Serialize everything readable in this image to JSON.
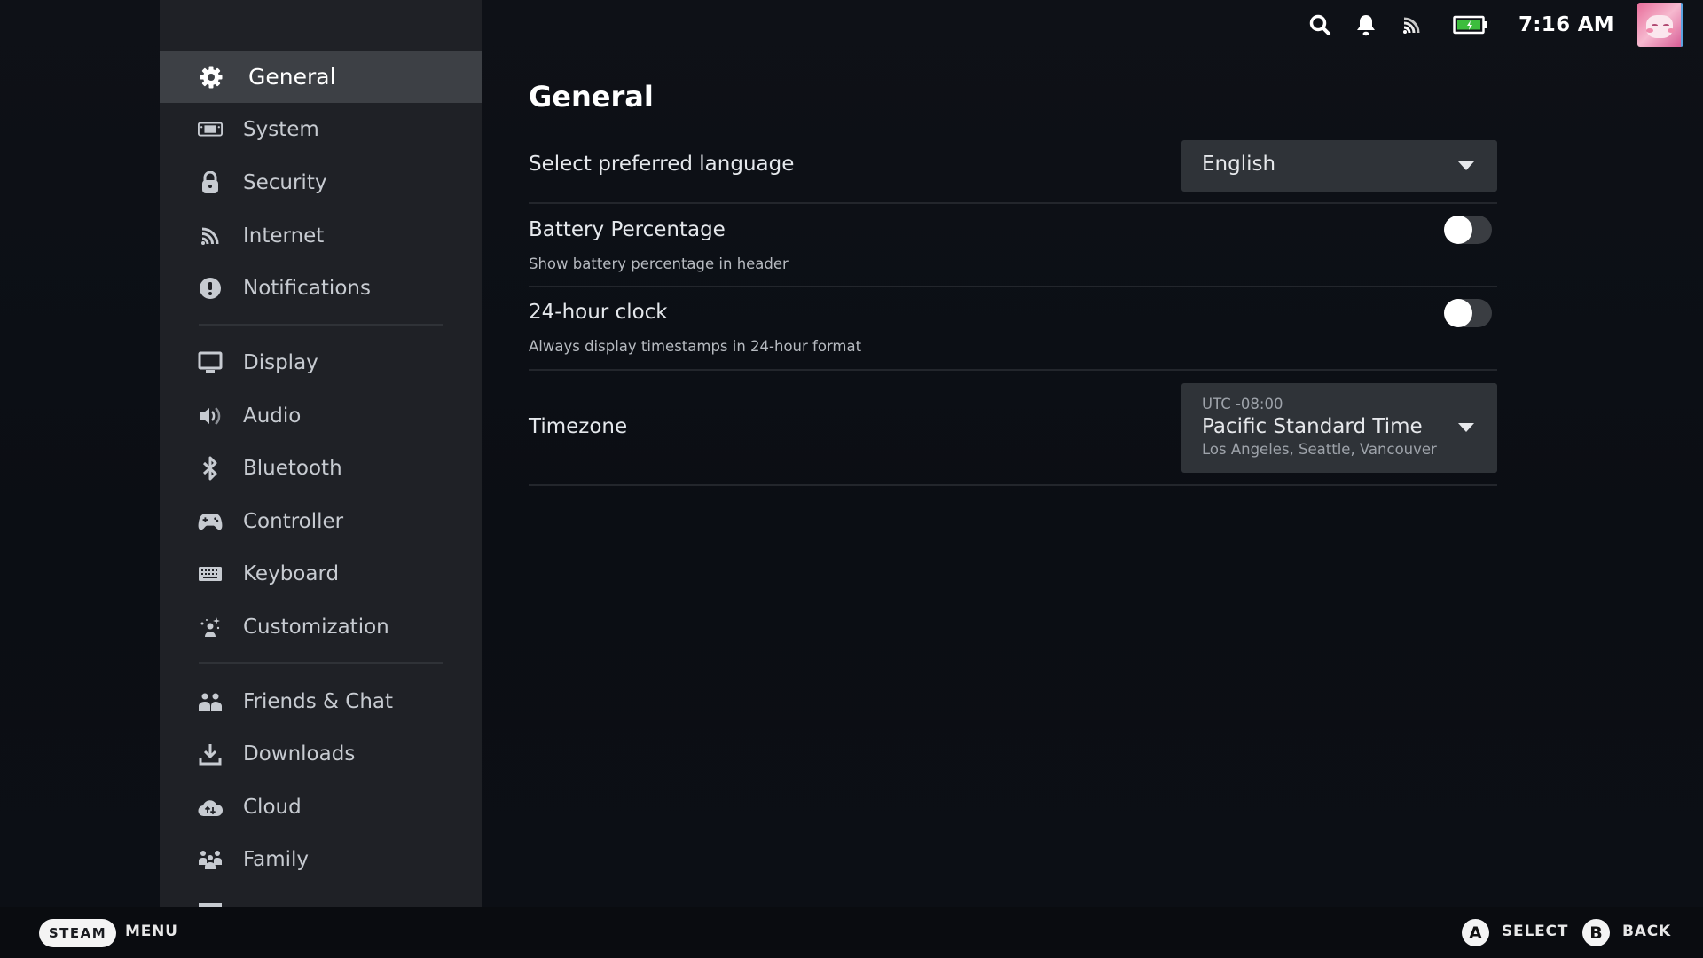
{
  "header": {
    "time": "7:16 AM",
    "icons": [
      "search-icon",
      "bell-icon",
      "wifi-icon",
      "battery-charging-icon",
      "avatar"
    ],
    "battery_color": "#3dbd3d"
  },
  "sidebar": {
    "items": [
      {
        "label": "General",
        "icon": "gear-icon",
        "active": true
      },
      {
        "label": "System",
        "icon": "handheld-device-icon"
      },
      {
        "label": "Security",
        "icon": "lock-icon"
      },
      {
        "label": "Internet",
        "icon": "wifi-icon"
      },
      {
        "label": "Notifications",
        "icon": "alert-circle-icon"
      },
      {
        "label": "Display",
        "icon": "monitor-icon"
      },
      {
        "label": "Audio",
        "icon": "speaker-icon"
      },
      {
        "label": "Bluetooth",
        "icon": "bluetooth-icon"
      },
      {
        "label": "Controller",
        "icon": "gamepad-icon"
      },
      {
        "label": "Keyboard",
        "icon": "keyboard-icon"
      },
      {
        "label": "Customization",
        "icon": "sparkle-person-icon"
      },
      {
        "label": "Friends & Chat",
        "icon": "friends-icon"
      },
      {
        "label": "Downloads",
        "icon": "download-icon"
      },
      {
        "label": "Cloud",
        "icon": "cloud-sync-icon"
      },
      {
        "label": "Family",
        "icon": "family-icon"
      }
    ]
  },
  "main": {
    "title": "General",
    "language": {
      "label": "Select preferred language",
      "value": "English"
    },
    "battery_percentage": {
      "label": "Battery Percentage",
      "description": "Show battery percentage in header",
      "enabled": false
    },
    "clock_24h": {
      "label": "24-hour clock",
      "description": "Always display timestamps in 24-hour format",
      "enabled": false
    },
    "timezone": {
      "label": "Timezone",
      "offset": "UTC -08:00",
      "name": "Pacific Standard Time",
      "cities": "Los Angeles, Seattle, Vancouver"
    }
  },
  "footer": {
    "steam_label": "STEAM",
    "menu_label": "MENU",
    "a_glyph": "A",
    "select_label": "SELECT",
    "b_glyph": "B",
    "back_label": "BACK"
  }
}
